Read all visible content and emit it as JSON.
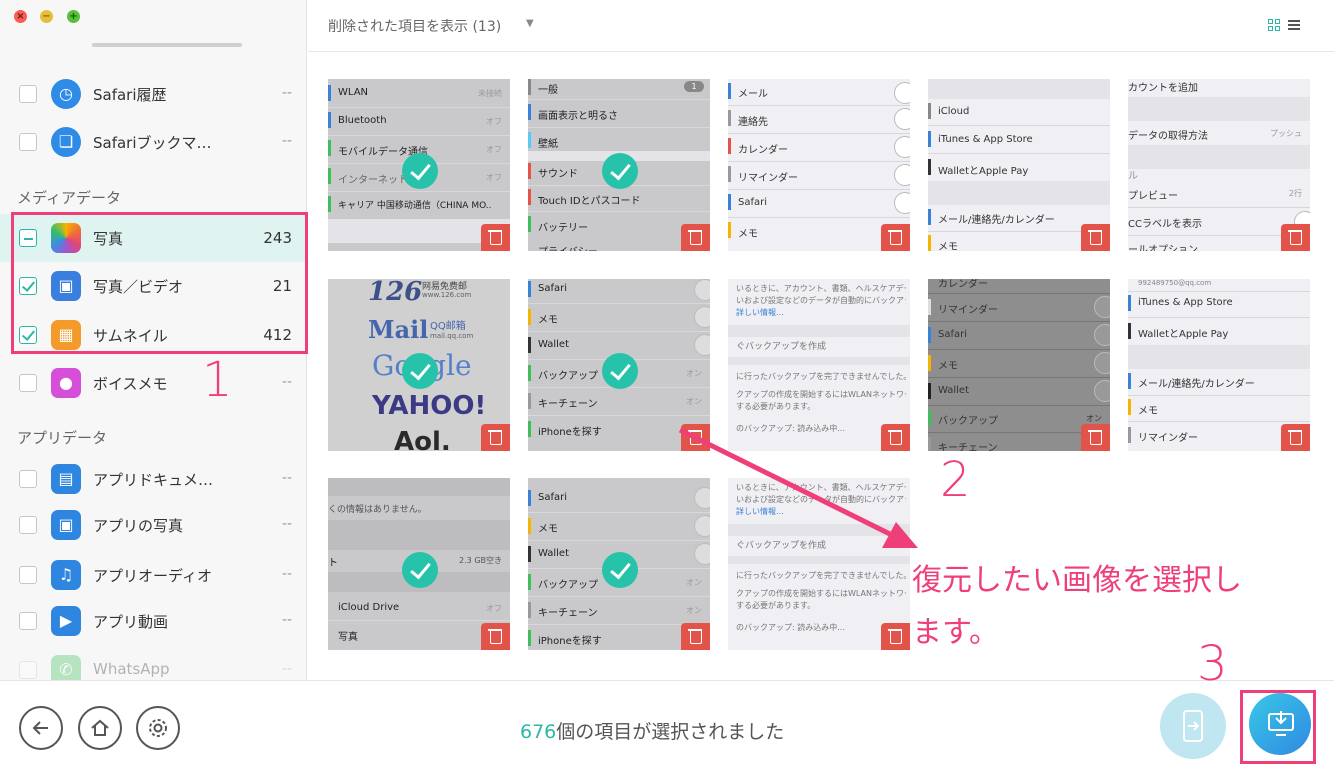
{
  "window": {
    "close_glyph": "×",
    "min_glyph": "−",
    "max_glyph": "+"
  },
  "sidebar": {
    "items_top": [
      {
        "label": "Safari履歴",
        "count": "--",
        "icon": "safari-history-icon"
      },
      {
        "label": "Safariブックマ…",
        "count": "--",
        "icon": "safari-bookmark-icon"
      }
    ],
    "media_heading": "メディアデータ",
    "media_items": [
      {
        "label": "写真",
        "count": "243",
        "icon": "photos-icon",
        "state": "partial"
      },
      {
        "label": "写真／ビデオ",
        "count": "21",
        "icon": "photo-video-icon",
        "state": "checked"
      },
      {
        "label": "サムネイル",
        "count": "412",
        "icon": "thumbnail-icon",
        "state": "checked"
      },
      {
        "label": "ボイスメモ",
        "count": "--",
        "icon": "voice-memo-icon",
        "state": "unchecked"
      }
    ],
    "app_heading": "アプリデータ",
    "app_items": [
      {
        "label": "アプリドキュメ…",
        "count": "--",
        "icon": "app-document-icon"
      },
      {
        "label": "アプリの写真",
        "count": "--",
        "icon": "app-photo-icon"
      },
      {
        "label": "アプリオーディオ",
        "count": "--",
        "icon": "app-audio-icon"
      },
      {
        "label": "アプリ動画",
        "count": "--",
        "icon": "app-video-icon"
      },
      {
        "label": "WhatsApp",
        "count": "--",
        "icon": "whatsapp-icon"
      }
    ]
  },
  "header": {
    "filter_label": "削除された項目を表示 (13)",
    "caret": "▼"
  },
  "tiles": {
    "t1": [
      "WLAN",
      "Bluetooth",
      "モバイルデータ通信",
      "インターネット共有",
      "キャリア 中国移动通信（CHINA MO..",
      "未接続",
      "オフ",
      "オフ",
      "オフ"
    ],
    "t2": [
      "一般",
      "画面表示と明るさ",
      "壁紙",
      "サウンド",
      "Touch IDとパスコード",
      "バッテリー",
      "プライバシー",
      "1"
    ],
    "t3": [
      "メール",
      "連絡先",
      "カレンダー",
      "リマインダー",
      "Safari",
      "メモ"
    ],
    "t4": [
      "iCloud",
      "iTunes & App Store",
      "WalletとApple Pay",
      "メール/連絡先/カレンダー",
      "メモ"
    ],
    "t5": [
      "カウントを追加",
      "データの取得方法",
      "プッシュ",
      "ル",
      "プレビュー",
      "2行",
      "CCラベルを表示",
      "ールオプション"
    ],
    "t6": [
      "126",
      "网易免费邮",
      "www.126.com",
      "Mail",
      "QQ邮箱",
      "mail.qq.com",
      "Google",
      "YAHOO!",
      "Aol."
    ],
    "t7": [
      "Safari",
      "メモ",
      "Wallet",
      "バックアップ",
      "キーチェーン",
      "iPhoneを探す",
      "オン",
      "オン"
    ],
    "t8": [
      "いるときに、アカウント、書類、ヘルスケアデータ、ホ",
      "いおよび設定などのデータが自動的にバックアップ",
      "詳しい情報...",
      "ぐバックアップを作成",
      "に行ったバックアップを完了できませんでした。",
      "クアップの作成を開始するにはWLANネットワー",
      "する必要があります。",
      "のバックアップ: 読み込み中..."
    ],
    "t9": [
      "カレンダー",
      "リマインダー",
      "Safari",
      "メモ",
      "Wallet",
      "バックアップ",
      "キーチェーン",
      "オン"
    ],
    "t10": [
      "992489750@qq.com",
      "iTunes & App Store",
      "WalletとApple Pay",
      "メール/連絡先/カレンダー",
      "メモ",
      "リマインダー"
    ],
    "t11": [
      "くの情報はありません。",
      "ト",
      "2.3 GB空き",
      "iCloud Drive",
      "写真",
      "オフ",
      "オン"
    ],
    "t12": [
      "Safari",
      "メモ",
      "Wallet",
      "バックアップ",
      "キーチェーン",
      "iPhoneを探す",
      "オン",
      "オン"
    ],
    "t13": [
      "いるときに、アカウント、書類、ヘルスケアデータ、ホ",
      "いおよび設定などのデータが自動的にバックアップ",
      "詳しい情報...",
      "ぐバックアップを作成",
      "に行ったバックアップを完了できませんでした。",
      "クアップの作成を開始するにはWLANネットワー",
      "する必要があります。",
      "のバックアップ: 読み込み中..."
    ]
  },
  "bottom": {
    "status_count": "676",
    "status_text": "個の項目が選択されました"
  },
  "annotations": {
    "n1": "1",
    "n2": "2",
    "n3": "3",
    "text": "復元したい画像を選択します。"
  },
  "colors": {
    "accent": "#2bb7a6",
    "annotation": "#ef3f79",
    "trash": "#e2544a"
  }
}
